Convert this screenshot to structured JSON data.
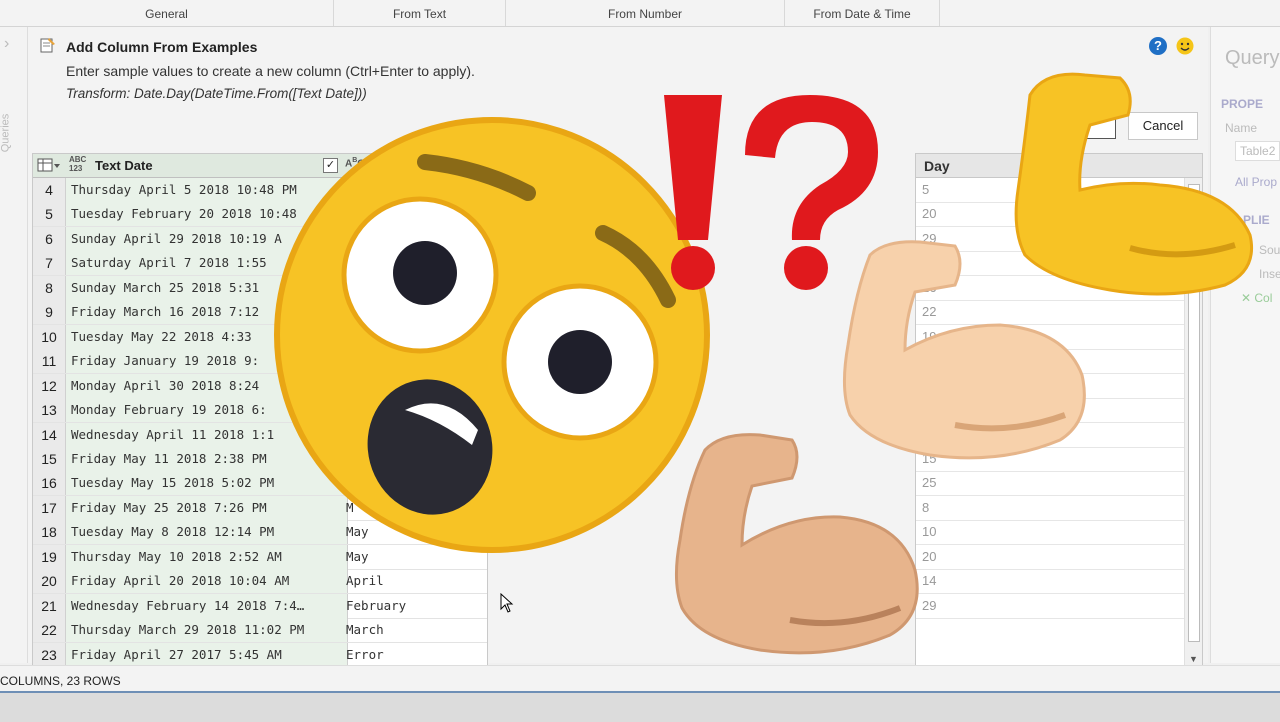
{
  "ribbon": {
    "groups": [
      "General",
      "From Text",
      "From Number",
      "From Date & Time"
    ]
  },
  "panel": {
    "title": "Add Column From Examples",
    "description": "Enter sample values to create a new column (Ctrl+Enter to apply).",
    "formula": "Transform: Date.Day(DateTime.From([Text Date]))",
    "cancel_label": "Cancel",
    "help_icon": "?"
  },
  "left_pane": {
    "label": "Queries",
    "chevron": "›"
  },
  "right_pane": {
    "title": "Query",
    "properties_heading": "PROPE",
    "name_label": "Name",
    "name_value": "Table2",
    "all_properties": "All Prop",
    "applied_heading": "PLIE",
    "steps": [
      "Sou",
      "Inse",
      "Col"
    ]
  },
  "grid": {
    "columns": {
      "row_num": "",
      "text_date": "Text Date",
      "type_icon": "ABC\n123",
      "new_type_icon": "A B C"
    },
    "rows": [
      {
        "n": "4",
        "text": "Thursday April 5 2018 10:48 PM",
        "example": ""
      },
      {
        "n": "5",
        "text": "Tuesday February 20 2018 10:48",
        "example": ""
      },
      {
        "n": "6",
        "text": "Sunday April 29 2018 10:19 A",
        "example": ""
      },
      {
        "n": "7",
        "text": "Saturday April 7 2018 1:55",
        "example": ""
      },
      {
        "n": "8",
        "text": "Sunday March 25 2018 5:31",
        "example": ""
      },
      {
        "n": "9",
        "text": "Friday March 16 2018 7:12",
        "example": ""
      },
      {
        "n": "10",
        "text": "Tuesday May 22 2018 4:33",
        "example": ""
      },
      {
        "n": "11",
        "text": "Friday January 19 2018 9:",
        "example": ""
      },
      {
        "n": "12",
        "text": "Monday April 30 2018 8:24",
        "example": ""
      },
      {
        "n": "13",
        "text": "Monday February 19 2018 6:",
        "example": ""
      },
      {
        "n": "14",
        "text": "Wednesday April 11 2018 1:1",
        "example": ""
      },
      {
        "n": "15",
        "text": "Friday May 11 2018 2:38 PM",
        "example": ""
      },
      {
        "n": "16",
        "text": "Tuesday May 15 2018 5:02 PM",
        "example": ""
      },
      {
        "n": "17",
        "text": "Friday May 25 2018 7:26 PM",
        "example": "M"
      },
      {
        "n": "18",
        "text": "Tuesday May 8 2018 12:14 PM",
        "example": "May"
      },
      {
        "n": "19",
        "text": "Thursday May 10 2018 2:52 AM",
        "example": "May"
      },
      {
        "n": "20",
        "text": "Friday April 20 2018 10:04 AM",
        "example": "April"
      },
      {
        "n": "21",
        "text": "Wednesday February 14 2018 7:4…",
        "example": "February"
      },
      {
        "n": "22",
        "text": "Thursday March 29 2018 11:02 PM",
        "example": "March"
      },
      {
        "n": "23",
        "text": "Friday April 27 2017 5:45 AM",
        "example": "Error"
      }
    ]
  },
  "day_grid": {
    "header": "Day",
    "values": [
      "5",
      "20",
      "29",
      "",
      "16",
      "22",
      "19",
      "",
      "",
      "",
      "11",
      "15",
      "25",
      "8",
      "10",
      "20",
      "14",
      "29"
    ]
  },
  "status": {
    "text": "COLUMNS, 23 ROWS"
  },
  "colors": {
    "accent_green": "#dfe9df",
    "help_blue": "#1f6fc5",
    "emoji_yellow": "#f7c325",
    "exclaim_red": "#e0191d"
  },
  "overlay_icons": [
    "flushed-face-emoji",
    "exclamation-question-icon",
    "flexed-biceps-yellow",
    "flexed-biceps-light",
    "flexed-biceps-medium"
  ]
}
